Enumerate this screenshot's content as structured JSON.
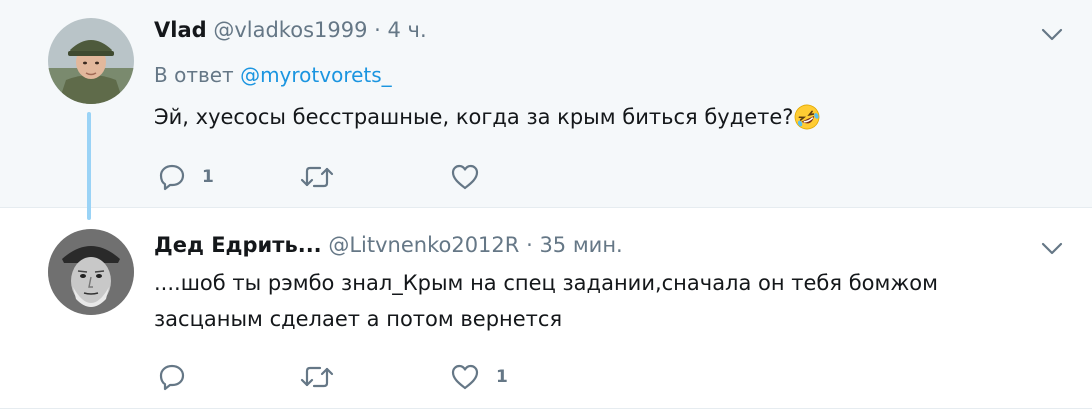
{
  "tweets": [
    {
      "author_name": "Vlad",
      "handle": "@vladkos1999",
      "separator": "·",
      "time": "4 ч.",
      "reply_prefix": "В ответ",
      "reply_mention": "@myrotvorets_",
      "text": "Эй, хуесосы бесстрашные, когда за крым биться будете?",
      "emoji": "rolling-on-floor-laughing",
      "reply_count": "1",
      "retweet_count": "",
      "like_count": ""
    },
    {
      "author_name": "Дед Едрить...",
      "handle": "@Litvnenko2012R",
      "separator": "·",
      "time": "35 мин.",
      "text": "....шоб ты рэмбо знал_Крым на спец задании,сначала он тебя бомжом засцаным сделает а потом вернется",
      "reply_count": "",
      "retweet_count": "",
      "like_count": "1"
    }
  ],
  "icons": {
    "reply": "reply-icon",
    "retweet": "retweet-icon",
    "like": "heart-icon",
    "menu": "chevron-down-icon"
  },
  "colors": {
    "thread_line": "#9ad3f6",
    "mention": "#1b95e0",
    "muted": "#657786",
    "text": "#14171a",
    "highlight_bg": "#f5f8fa"
  }
}
